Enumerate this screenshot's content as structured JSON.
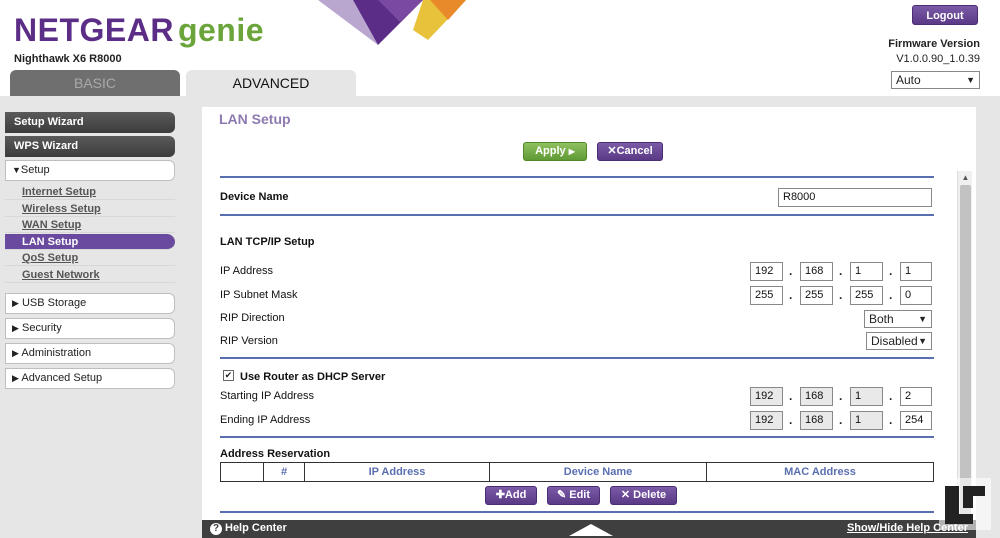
{
  "header": {
    "brand": "NETGEAR",
    "product": "genie",
    "model": "Nighthawk X6 R8000",
    "logout_label": "Logout",
    "firmware_title": "Firmware Version",
    "firmware_value": "V1.0.0.90_1.0.39",
    "language_selected": "Auto",
    "tabs": [
      {
        "label": "BASIC",
        "active": false
      },
      {
        "label": "ADVANCED",
        "active": true
      }
    ]
  },
  "sidebar": {
    "setup_wizard": "Setup Wizard",
    "wps_wizard": "WPS Wizard",
    "setup": "Setup",
    "setup_items": [
      {
        "label": "Internet Setup",
        "active": false
      },
      {
        "label": "Wireless Setup",
        "active": false
      },
      {
        "label": "WAN Setup",
        "active": false
      },
      {
        "label": "LAN Setup",
        "active": true
      },
      {
        "label": "QoS Setup",
        "active": false
      },
      {
        "label": "Guest Network",
        "active": false
      }
    ],
    "usb_storage": "USB Storage",
    "security": "Security",
    "administration": "Administration",
    "advanced_setup": "Advanced Setup"
  },
  "main": {
    "title": "LAN Setup",
    "apply_label": "Apply",
    "cancel_label": "Cancel",
    "device_name_label": "Device Name",
    "device_name_value": "R8000",
    "lan_tcpip_header": "LAN TCP/IP Setup",
    "ip_address_label": "IP Address",
    "ip_address": [
      "192",
      "168",
      "1",
      "1"
    ],
    "subnet_label": "IP Subnet Mask",
    "subnet": [
      "255",
      "255",
      "255",
      "0"
    ],
    "rip_direction_label": "RIP Direction",
    "rip_direction_value": "Both",
    "rip_version_label": "RIP Version",
    "rip_version_value": "Disabled",
    "dhcp_label": "Use Router as DHCP Server",
    "dhcp_checked": true,
    "start_ip_label": "Starting IP Address",
    "start_ip": [
      "192",
      "168",
      "1",
      "2"
    ],
    "end_ip_label": "Ending IP Address",
    "end_ip": [
      "192",
      "168",
      "1",
      "254"
    ],
    "reservation_header": "Address Reservation",
    "table_columns": [
      "",
      "#",
      "IP Address",
      "Device Name",
      "MAC Address"
    ],
    "add_label": "Add",
    "edit_label": "Edit",
    "delete_label": "Delete"
  },
  "footer": {
    "help_center": "Help Center",
    "show_hide": "Show/Hide Help Center"
  },
  "colors": {
    "brand_purple": "#5b2d86",
    "genie_green": "#6ba43a",
    "section_line": "#5a6fb0",
    "active_nav": "#6a4a9e"
  }
}
